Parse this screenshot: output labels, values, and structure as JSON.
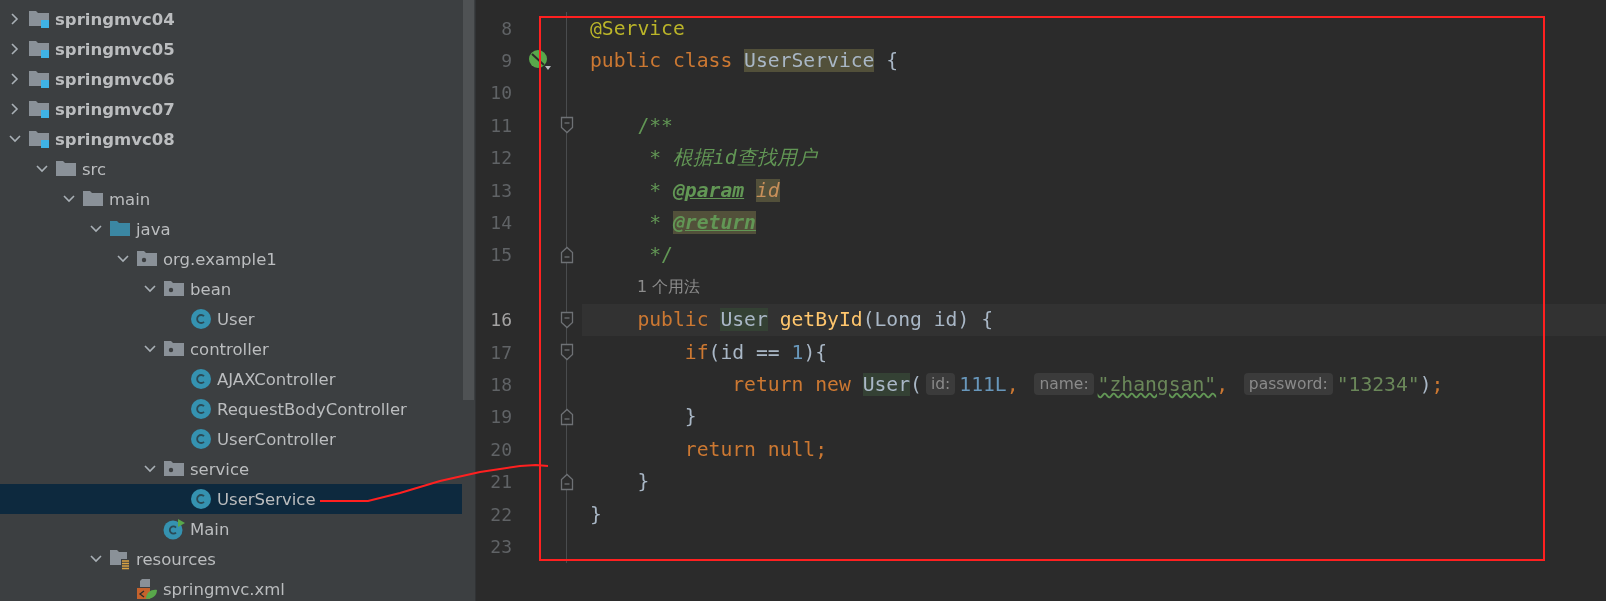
{
  "project_tree": {
    "items": [
      {
        "label": "springmvc04",
        "kind": "module",
        "expanded": false,
        "selected": false
      },
      {
        "label": "springmvc05",
        "kind": "module",
        "expanded": false,
        "selected": false
      },
      {
        "label": "springmvc06",
        "kind": "module",
        "expanded": false,
        "selected": false
      },
      {
        "label": "springmvc07",
        "kind": "module",
        "expanded": false,
        "selected": false
      },
      {
        "label": "springmvc08",
        "kind": "module",
        "expanded": true,
        "selected": false,
        "children": [
          {
            "label": "src",
            "kind": "folder",
            "expanded": true,
            "selected": false,
            "children": [
              {
                "label": "main",
                "kind": "folder",
                "expanded": true,
                "selected": false,
                "children": [
                  {
                    "label": "java",
                    "kind": "source-folder",
                    "expanded": true,
                    "selected": false,
                    "children": [
                      {
                        "label": "org.example1",
                        "kind": "package",
                        "expanded": true,
                        "selected": false,
                        "children": [
                          {
                            "label": "bean",
                            "kind": "package",
                            "expanded": true,
                            "selected": false,
                            "children": [
                              {
                                "label": "User",
                                "kind": "class",
                                "selected": false
                              }
                            ]
                          },
                          {
                            "label": "controller",
                            "kind": "package",
                            "expanded": true,
                            "selected": false,
                            "children": [
                              {
                                "label": "AJAXController",
                                "kind": "class",
                                "selected": false
                              },
                              {
                                "label": "RequestBodyController",
                                "kind": "class",
                                "selected": false
                              },
                              {
                                "label": "UserController",
                                "kind": "class",
                                "selected": false
                              }
                            ]
                          },
                          {
                            "label": "service",
                            "kind": "package",
                            "expanded": true,
                            "selected": false,
                            "children": [
                              {
                                "label": "UserService",
                                "kind": "class",
                                "selected": true
                              }
                            ]
                          },
                          {
                            "label": "Main",
                            "kind": "main-class",
                            "selected": false
                          }
                        ]
                      }
                    ]
                  },
                  {
                    "label": "resources",
                    "kind": "resources",
                    "expanded": true,
                    "selected": false,
                    "children": [
                      {
                        "label": "springmvc.xml",
                        "kind": "xml",
                        "selected": false
                      }
                    ]
                  }
                ]
              }
            ]
          }
        ]
      }
    ]
  },
  "editor": {
    "lines": [
      {
        "kind": "code",
        "number": "8",
        "tokens": [
          {
            "text": "@Service",
            "kind": "annotation"
          }
        ]
      },
      {
        "kind": "code",
        "number": "9",
        "bean_icon": true,
        "tokens": [
          {
            "text": "public class ",
            "kind": "keyword"
          },
          {
            "text": "UserService",
            "kind": "class-decl",
            "highlighted": true
          },
          {
            "text": " {",
            "kind": "plain"
          }
        ]
      },
      {
        "kind": "code",
        "number": "10"
      },
      {
        "kind": "code",
        "number": "11",
        "fold_start": true,
        "tokens": [
          {
            "text": "    /**",
            "kind": "comment"
          }
        ]
      },
      {
        "kind": "code",
        "number": "12",
        "tokens": [
          {
            "text": "     * ",
            "kind": "comment"
          },
          {
            "text": "根据id查找用户",
            "kind": "comment-italic"
          }
        ]
      },
      {
        "kind": "code",
        "number": "13",
        "tokens": [
          {
            "text": "     * ",
            "kind": "comment"
          },
          {
            "text": "@param",
            "kind": "doc-tag",
            "highlighted": false
          },
          {
            "text": "id",
            "kind": "doc-param",
            "highlighted": true
          }
        ]
      },
      {
        "kind": "code",
        "number": "14",
        "tokens": [
          {
            "text": "     * ",
            "kind": "comment"
          },
          {
            "text": "@return",
            "kind": "doc-tag",
            "highlighted": true
          }
        ]
      },
      {
        "kind": "code",
        "number": "15",
        "fold_end": true,
        "tokens": [
          {
            "text": "     */",
            "kind": "comment"
          }
        ]
      },
      {
        "kind": "lens",
        "text": "1 个用法"
      },
      {
        "kind": "code",
        "number": "16",
        "current": true,
        "fold_start": true,
        "tokens": [
          {
            "text": "    public ",
            "kind": "keyword"
          },
          {
            "text": "User",
            "kind": "class-ref",
            "highlighted": true
          },
          {
            "text": "getById",
            "kind": "method"
          },
          {
            "text": "(Long id) {",
            "kind": "plain"
          }
        ]
      },
      {
        "kind": "code",
        "number": "17",
        "fold_start": true,
        "tokens": [
          {
            "text": "        if",
            "kind": "keyword"
          },
          {
            "text": "(id == ",
            "kind": "plain"
          },
          {
            "text": "1",
            "kind": "number"
          },
          {
            "text": "){",
            "kind": "plain"
          }
        ]
      },
      {
        "kind": "code",
        "number": "18",
        "tokens": [
          {
            "text": "            return new ",
            "kind": "keyword"
          },
          {
            "text": "User",
            "kind": "class-ref",
            "highlighted": true
          },
          {
            "text": "(",
            "kind": "plain"
          },
          {
            "text": "id:",
            "kind": "hint"
          },
          {
            "text": "111L",
            "kind": "number"
          },
          {
            "text": ", ",
            "kind": "keyword"
          },
          {
            "text": "name:",
            "kind": "hint"
          },
          {
            "text": "\"zhangsan\"",
            "kind": "string",
            "typo": true
          },
          {
            "text": ", ",
            "kind": "keyword"
          },
          {
            "text": "password:",
            "kind": "hint"
          },
          {
            "text": "\"13234\"",
            "kind": "string"
          },
          {
            "text": ")",
            "kind": "plain"
          },
          {
            "text": ";",
            "kind": "keyword"
          }
        ]
      },
      {
        "kind": "code",
        "number": "19",
        "fold_end": true,
        "tokens": [
          {
            "text": "        }",
            "kind": "plain"
          }
        ]
      },
      {
        "kind": "code",
        "number": "20",
        "tokens": [
          {
            "text": "        return null;",
            "kind": "keyword"
          }
        ]
      },
      {
        "kind": "code",
        "number": "21",
        "fold_end": true,
        "tokens": [
          {
            "text": "    }",
            "kind": "plain"
          }
        ]
      },
      {
        "kind": "code",
        "number": "22",
        "tokens": [
          {
            "text": "}",
            "kind": "plain"
          }
        ]
      },
      {
        "kind": "code",
        "number": "23"
      }
    ]
  }
}
